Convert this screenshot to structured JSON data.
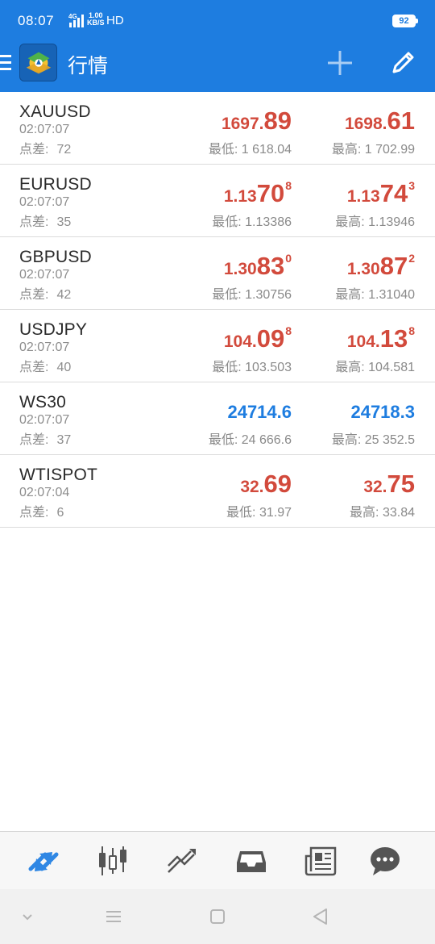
{
  "status": {
    "time": "08:07",
    "network": "4G",
    "speed_top": "1.00",
    "speed_bottom": "KB/S",
    "hd": "HD",
    "battery": "92"
  },
  "appbar": {
    "title": "行情",
    "icons": [
      "menu-icon",
      "app-logo",
      "plus-icon",
      "edit-icon"
    ]
  },
  "labels": {
    "spread": "点差:",
    "low": "最低:",
    "high": "最高:"
  },
  "quotes": [
    {
      "symbol": "XAUUSD",
      "time": "02:07:07",
      "spread": "72",
      "color": "red",
      "bid": {
        "small": "1697.",
        "big": "89",
        "sup": ""
      },
      "ask": {
        "small": "1698.",
        "big": "61",
        "sup": ""
      },
      "low": "1 618.04",
      "high": "1 702.99"
    },
    {
      "symbol": "EURUSD",
      "time": "02:07:07",
      "spread": "35",
      "color": "red",
      "bid": {
        "small": "1.13",
        "big": "70",
        "sup": "8"
      },
      "ask": {
        "small": "1.13",
        "big": "74",
        "sup": "3"
      },
      "low": "1.13386",
      "high": "1.13946"
    },
    {
      "symbol": "GBPUSD",
      "time": "02:07:07",
      "spread": "42",
      "color": "red",
      "bid": {
        "small": "1.30",
        "big": "83",
        "sup": "0"
      },
      "ask": {
        "small": "1.30",
        "big": "87",
        "sup": "2"
      },
      "low": "1.30756",
      "high": "1.31040"
    },
    {
      "symbol": "USDJPY",
      "time": "02:07:07",
      "spread": "40",
      "color": "red",
      "bid": {
        "small": "104.",
        "big": "09",
        "sup": "8"
      },
      "ask": {
        "small": "104.",
        "big": "13",
        "sup": "8"
      },
      "low": "103.503",
      "high": "104.581"
    },
    {
      "symbol": "WS30",
      "time": "02:07:07",
      "spread": "37",
      "color": "blue",
      "bid_plain": "24714.6",
      "ask_plain": "24718.3",
      "low": "24 666.6",
      "high": "25 352.5"
    },
    {
      "symbol": "WTISPOT",
      "time": "02:07:04",
      "spread": "6",
      "color": "red",
      "bid": {
        "small": "32.",
        "big": "69",
        "sup": ""
      },
      "ask": {
        "small": "32.",
        "big": "75",
        "sup": ""
      },
      "low": "31.97",
      "high": "33.84"
    }
  ],
  "tabs": [
    "quotes-icon",
    "chart-icon",
    "trade-icon",
    "history-icon",
    "news-icon",
    "messages-icon"
  ],
  "nav": [
    "collapse-icon",
    "menu-lines-icon",
    "home-square-icon",
    "back-triangle-icon"
  ],
  "colors": {
    "brand": "#1e7de0",
    "price_up": "#d24a3c",
    "price_blue": "#1e7de0",
    "tab_active": "#2f87e4",
    "tab_inactive": "#555555"
  }
}
